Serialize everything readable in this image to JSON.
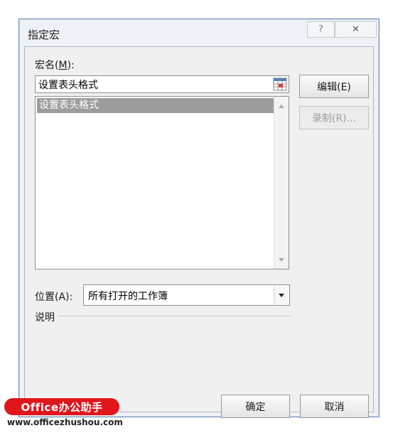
{
  "window": {
    "title": "指定宏",
    "help_glyph": "?",
    "close_glyph": "✕"
  },
  "macro_name": {
    "label_prefix": "宏名(",
    "label_key": "M",
    "label_suffix": "):",
    "value": "设置表头格式"
  },
  "macro_list": {
    "items": [
      "设置表头格式"
    ],
    "selected_index": 0
  },
  "buttons": {
    "edit_label": "编辑(E)",
    "record_label": "录制(R)...",
    "ok_label": "确定",
    "cancel_label": "取消"
  },
  "location": {
    "label": "位置(A):",
    "value": "所有打开的工作簿"
  },
  "description": {
    "label": "说明"
  },
  "watermark": {
    "brand": "Office办公助手",
    "url": "www.officezhushou.com"
  },
  "colors": {
    "selected_item_bg": "#9c9c9c",
    "watermark_red": "#e0161c"
  }
}
